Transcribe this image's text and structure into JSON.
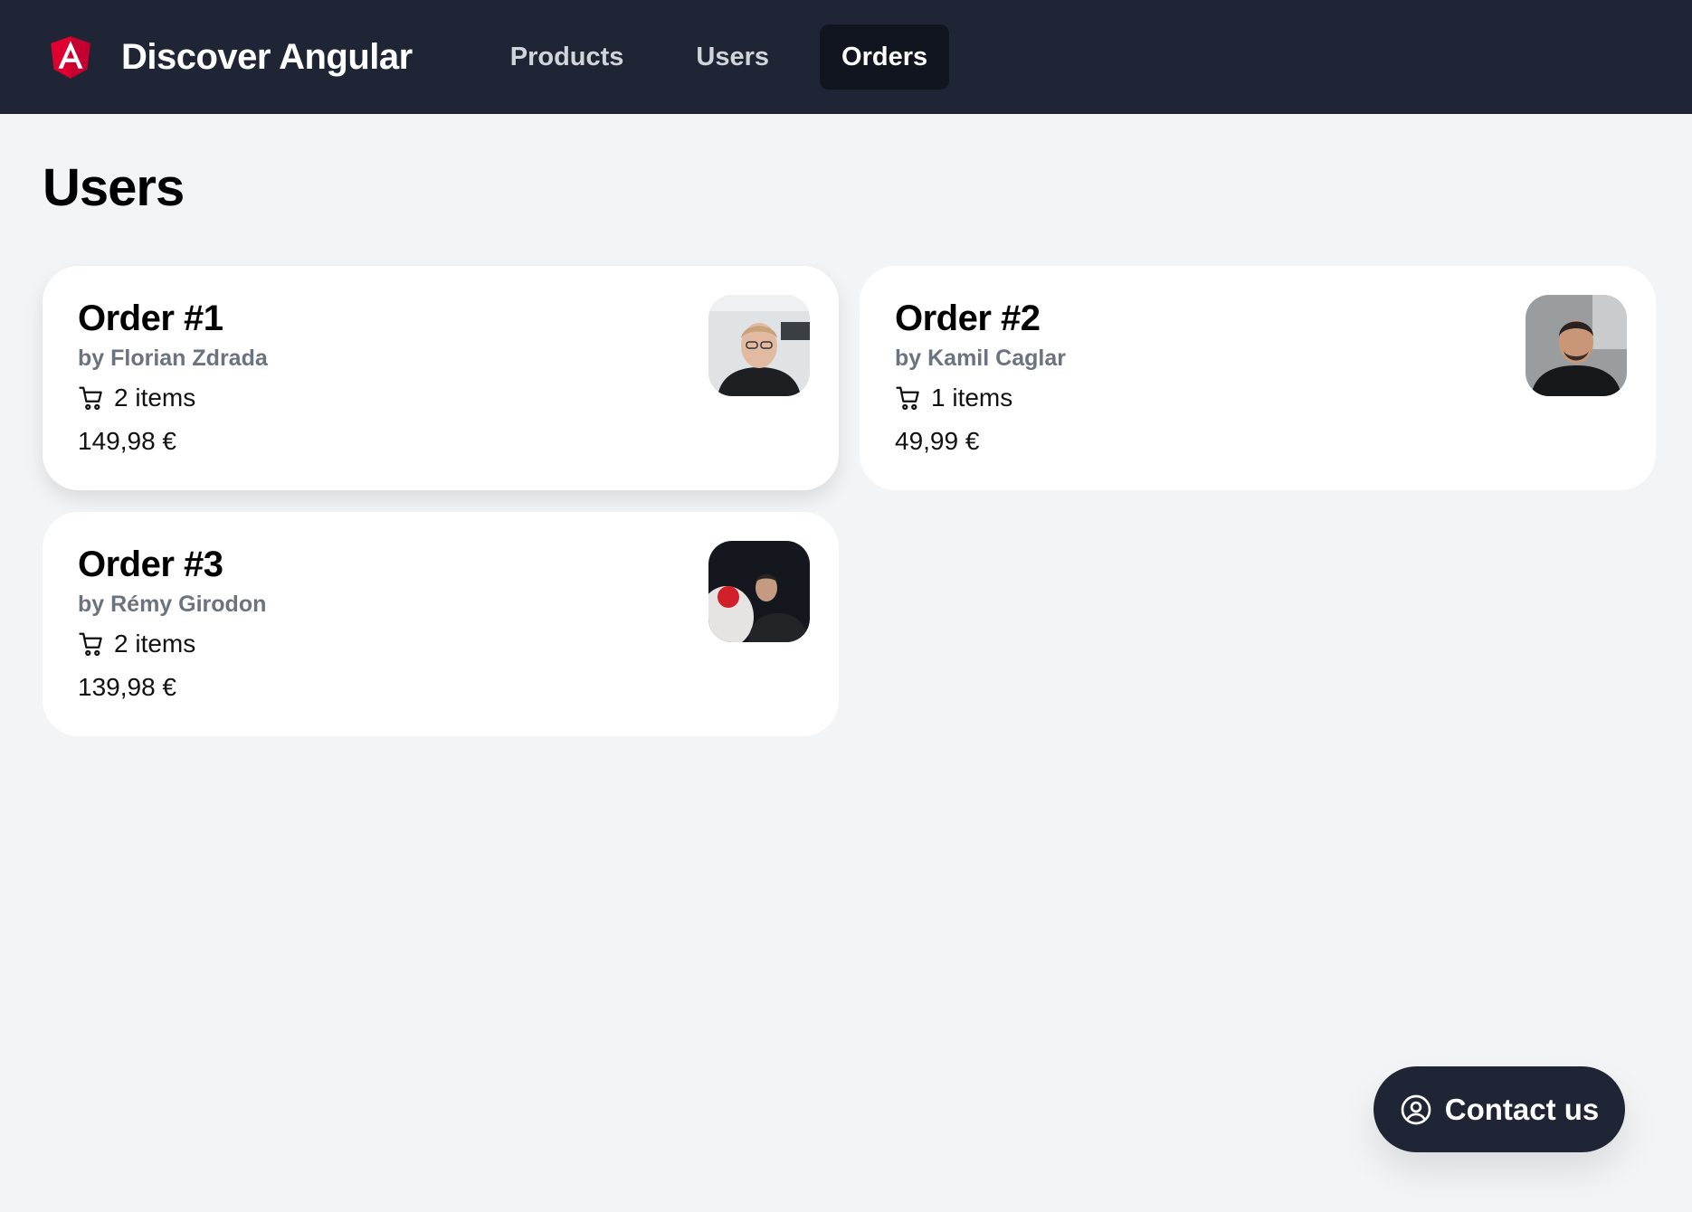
{
  "header": {
    "brand_title": "Discover Angular",
    "logo_icon": "angular-logo-icon",
    "brand_color": "#dd0031",
    "background": "#1f2535",
    "nav": [
      {
        "label": "Products",
        "active": false
      },
      {
        "label": "Users",
        "active": false
      },
      {
        "label": "Orders",
        "active": true
      }
    ]
  },
  "page": {
    "title": "Users",
    "background": "#f3f4f6"
  },
  "orders": [
    {
      "title": "Order #1",
      "author": "by Florian Zdrada",
      "items": "2 items",
      "price": "149,98 €",
      "icon": "cart-icon"
    },
    {
      "title": "Order #2",
      "author": "by Kamil Caglar",
      "items": "1 items",
      "price": "49,99 €",
      "icon": "cart-icon"
    },
    {
      "title": "Order #3",
      "author": "by Rémy Girodon",
      "items": "2 items",
      "price": "139,98 €",
      "icon": "cart-icon"
    }
  ],
  "contact_button": {
    "label": "Contact us",
    "icon": "user-circle-icon"
  }
}
